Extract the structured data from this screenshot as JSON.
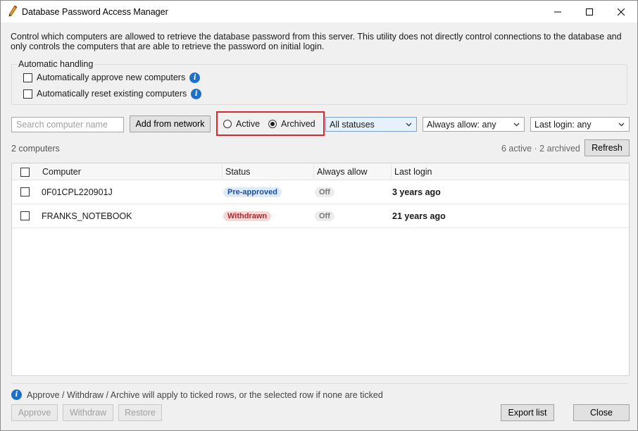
{
  "window": {
    "title": "Database Password Access Manager"
  },
  "description": "Control which computers are allowed to retrieve the database password from this server. This utility does not directly control connections to the database and only controls the computers that are able to retrieve the password on initial login.",
  "automatic_handling": {
    "label": "Automatic handling",
    "options": [
      {
        "label": "Automatically approve new computers",
        "checked": false
      },
      {
        "label": "Automatically reset existing computers",
        "checked": false
      }
    ]
  },
  "toolbar": {
    "search_placeholder": "Search computer name",
    "search_value": "",
    "add_from_network_label": "Add from network",
    "view_mode": {
      "options": [
        "Active",
        "Archived"
      ],
      "selected": "Archived"
    },
    "status_filter": "All statuses",
    "always_allow_filter": "Always allow: any",
    "last_login_filter": "Last login: any"
  },
  "counts": {
    "computers": "2 computers",
    "summary": "6 active · 2 archived",
    "refresh_label": "Refresh"
  },
  "table": {
    "columns": [
      "Computer",
      "Status",
      "Always allow",
      "Last login"
    ],
    "rows": [
      {
        "computer": "0F01CPL220901J",
        "status": "Pre-approved",
        "status_color": "#1f4fa0",
        "always_allow": "Off",
        "last_login": "3 years ago"
      },
      {
        "computer": "FRANKS_NOTEBOOK",
        "status": "Withdrawn",
        "status_color": "#b0282d",
        "always_allow": "Off",
        "last_login": "21 years ago"
      }
    ]
  },
  "footer": {
    "info_text": "Approve / Withdraw / Archive will apply to ticked rows, or the selected row if none are ticked",
    "approve_label": "Approve",
    "withdraw_label": "Withdraw",
    "restore_label": "Restore",
    "export_label": "Export list",
    "close_label": "Close"
  },
  "icons": {
    "app": "pencil-icon",
    "info": "info-icon",
    "minimize": "minimize-icon",
    "maximize": "maximize-icon",
    "close": "close-icon",
    "dropdown": "chevron-down-icon"
  },
  "colors": {
    "highlight_border": "#d9282f",
    "info_blue": "#1d6fc7"
  }
}
